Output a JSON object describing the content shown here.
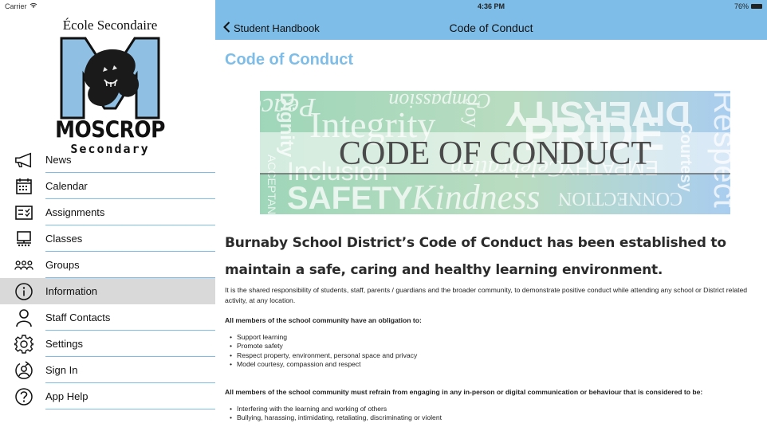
{
  "status": {
    "carrier": "Carrier",
    "time": "4:36 PM",
    "battery": "76%"
  },
  "logo": {
    "title": "École Secondaire",
    "brand": "MOSCROP",
    "sub": "Secondary"
  },
  "sidebar": {
    "items": [
      {
        "label": "News",
        "icon": "megaphone-icon"
      },
      {
        "label": "Calendar",
        "icon": "calendar-icon"
      },
      {
        "label": "Assignments",
        "icon": "assignments-icon"
      },
      {
        "label": "Classes",
        "icon": "classes-icon"
      },
      {
        "label": "Groups",
        "icon": "groups-icon"
      },
      {
        "label": "Information",
        "icon": "info-icon",
        "active": true
      },
      {
        "label": "Staff Contacts",
        "icon": "person-icon"
      },
      {
        "label": "Settings",
        "icon": "gear-icon"
      },
      {
        "label": "Sign In",
        "icon": "sign-in-icon"
      },
      {
        "label": "App Help",
        "icon": "help-icon"
      }
    ]
  },
  "nav": {
    "back_label": "Student Handbook",
    "title": "Code of Conduct"
  },
  "content": {
    "heading": "Code of Conduct",
    "banner": {
      "title": "CODE OF CONDUCT",
      "words": [
        "Dignity",
        "Peace",
        "Compassion",
        "DIVERSITY",
        "Respect",
        "ACCEPTANCE",
        "Integrity",
        "Joy",
        "PRIDE",
        "Courtesy",
        "Inclusion",
        "Celebration",
        "EMPATHY",
        "SAFETY",
        "Kindness",
        "CONNECTION"
      ]
    },
    "lead": "Burnaby School District’s Code of Conduct has been established to maintain a safe, caring and healthy learning environment.",
    "intro": "It is the shared responsibility of students, staff, parents / guardians and the broader community, to demonstrate positive conduct while attending any school or District related activity, at any location.",
    "obligation_heading": "All members of the school community have an obligation to:",
    "obligations": [
      "Support learning",
      "Promote safety",
      "Respect property, environment, personal space and privacy",
      "Model courtesy, compassion and respect"
    ],
    "refrain_heading": "All members of the school community must refrain from engaging in any in-person or digital communication or behaviour that is considered to be:",
    "refrain": [
      "Interfering with the learning and working of others",
      "Bullying, harassing, intimidating, retaliating, discriminating or violent"
    ]
  },
  "colors": {
    "accent": "#7ebde8",
    "active_bg": "#d9d9d9",
    "banner_green": "#9fd6b9",
    "banner_blue": "#a9cdef"
  }
}
